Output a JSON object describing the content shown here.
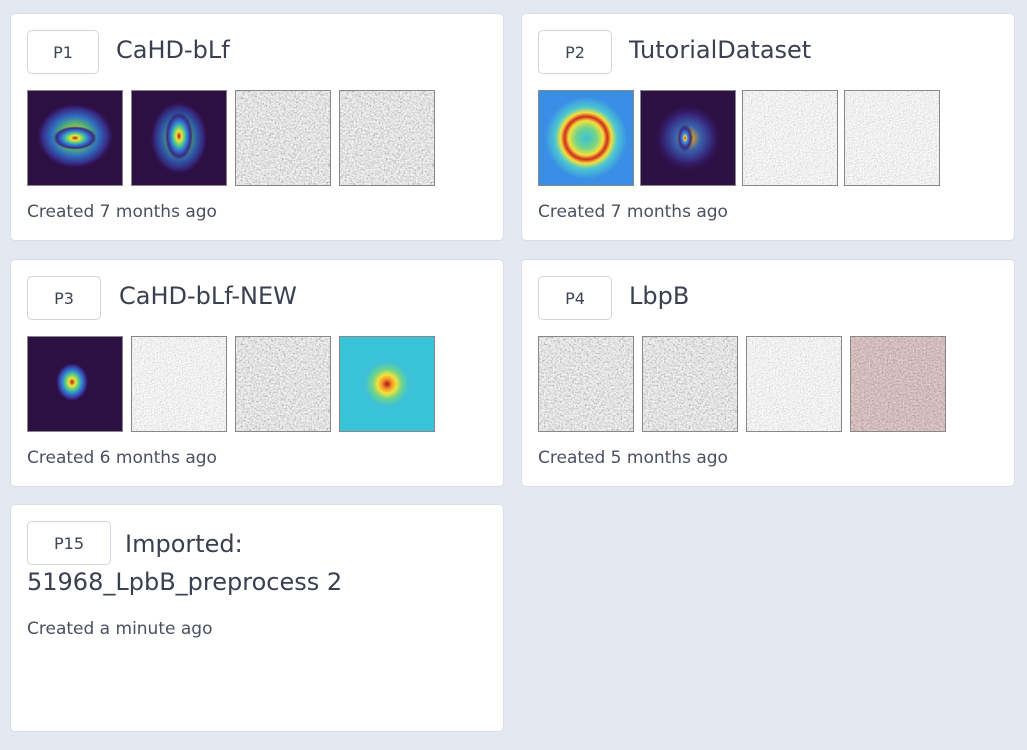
{
  "projects": [
    {
      "id": "P1",
      "name": "CaHD-bLf",
      "created": "Created 7 months ago",
      "thumbnails": [
        "heatmap-blob-icon",
        "heatmap-elongated-icon",
        "micrograph-icon",
        "micrograph-icon"
      ]
    },
    {
      "id": "P2",
      "name": "TutorialDataset",
      "created": "Created 7 months ago",
      "thumbnails": [
        "heatmap-ring-icon",
        "heatmap-dot-icon",
        "micrograph-icon",
        "micrograph-icon"
      ]
    },
    {
      "id": "P3",
      "name": "CaHD-bLf-NEW",
      "created": "Created 6 months ago",
      "thumbnails": [
        "heatmap-small-blob-icon",
        "micrograph-icon",
        "micrograph-icon",
        "heatmap-cyan-icon"
      ]
    },
    {
      "id": "P4",
      "name": "LbpB",
      "created": "Created 5 months ago",
      "thumbnails": [
        "micrograph-icon",
        "micrograph-icon",
        "micrograph-icon",
        "micrograph-tinted-icon"
      ]
    },
    {
      "id": "P15",
      "name_line1": "Imported:",
      "name_line2": "51968_LpbB_preprocess 2",
      "created": "Created a minute ago"
    }
  ],
  "colors": {
    "background": "#e4e8f1",
    "card": "#ffffff",
    "text": "#3b4050",
    "heatmap_dark": "#2c0f43",
    "heatmap_blue": "#3a8ee6",
    "heatmap_cyan": "#39c3d8"
  }
}
